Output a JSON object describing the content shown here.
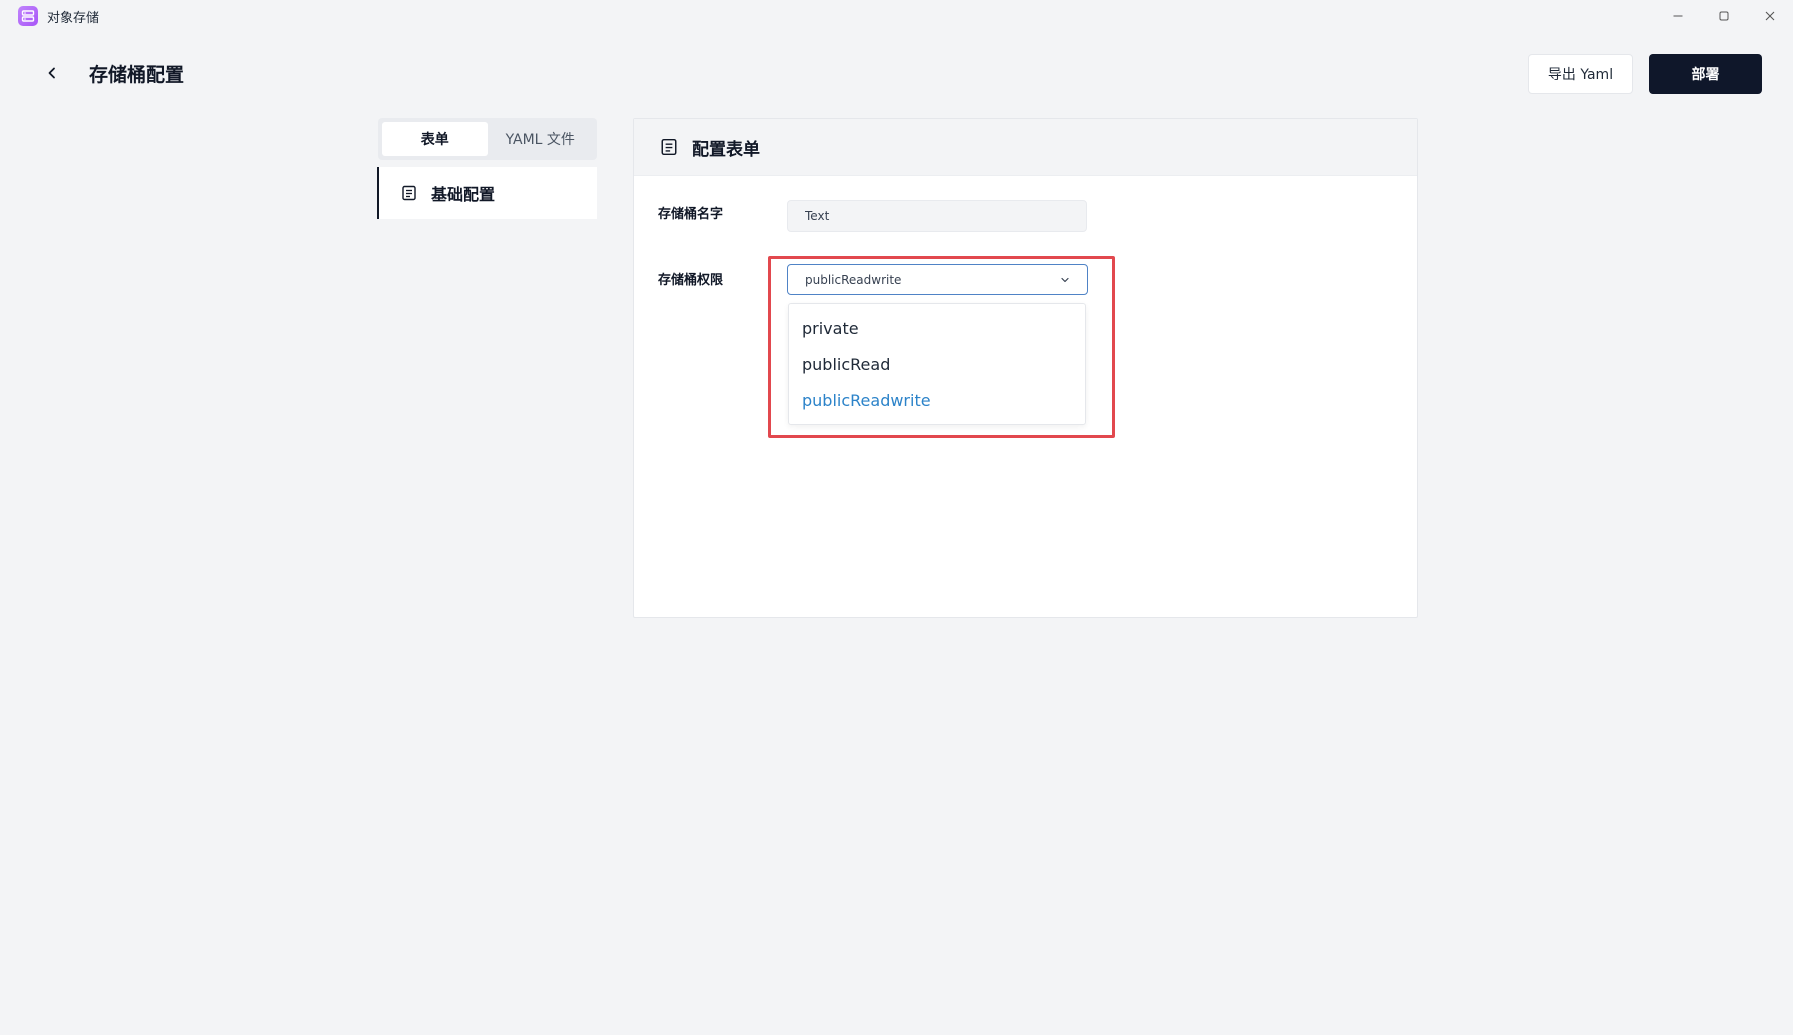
{
  "window": {
    "title": "对象存储",
    "app_icon": "storage-app-icon",
    "controls": [
      "minimize-icon",
      "maximize-icon",
      "close-icon"
    ]
  },
  "header": {
    "title": "存储桶配置",
    "export_label": "导出 Yaml",
    "deploy_label": "部署"
  },
  "sidebar": {
    "tabs": [
      {
        "label": "表单",
        "active": true
      },
      {
        "label": "YAML 文件",
        "active": false
      }
    ],
    "nav_items": [
      {
        "label": "基础配置",
        "icon": "document-list-icon",
        "active": true
      }
    ]
  },
  "form": {
    "title": "配置表单",
    "fields": {
      "name": {
        "label": "存储桶名字",
        "value": "Text"
      },
      "permission": {
        "label": "存储桶权限",
        "value": "publicReadwrite",
        "options": [
          "private",
          "publicRead",
          "publicReadwrite"
        ],
        "selected_index": 2
      }
    }
  },
  "colors": {
    "accent_selected": "#2c83c9",
    "primary_button": "#0f172a",
    "highlight": "#e2484e",
    "select_border": "#4f83c6"
  }
}
